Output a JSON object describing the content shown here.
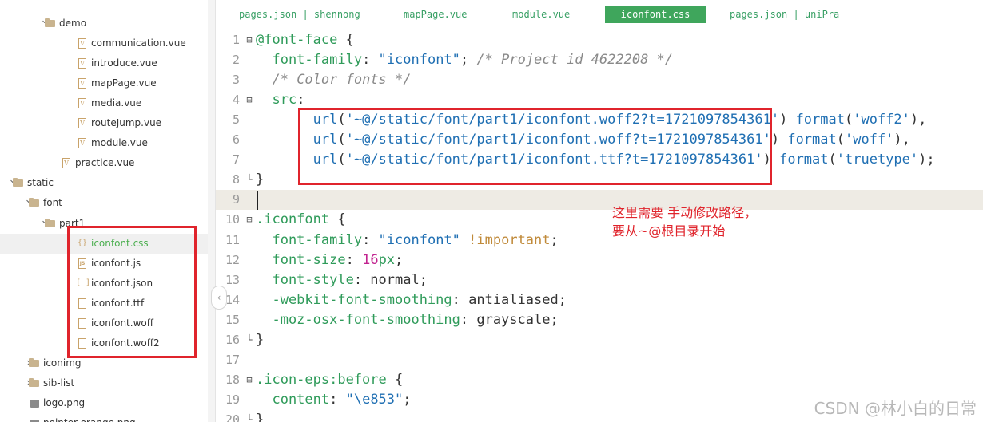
{
  "sidebar": {
    "items": [
      {
        "label": "demo",
        "type": "folder",
        "expanded": true,
        "depth": 3
      },
      {
        "label": "communication.vue",
        "type": "vue",
        "depth": 5
      },
      {
        "label": "introduce.vue",
        "type": "vue",
        "depth": 5
      },
      {
        "label": "mapPage.vue",
        "type": "vue",
        "depth": 5
      },
      {
        "label": "media.vue",
        "type": "vue",
        "depth": 5
      },
      {
        "label": "routeJump.vue",
        "type": "vue",
        "depth": 5
      },
      {
        "label": "module.vue",
        "type": "vue",
        "depth": 5
      },
      {
        "label": "practice.vue",
        "type": "vue",
        "depth": 4
      },
      {
        "label": "static",
        "type": "folder",
        "expanded": true,
        "depth": 1
      },
      {
        "label": "font",
        "type": "folder",
        "expanded": true,
        "depth": 2
      },
      {
        "label": "part1",
        "type": "folder",
        "expanded": true,
        "depth": 3
      },
      {
        "label": "iconfont.css",
        "type": "css",
        "depth": 5,
        "selected": true
      },
      {
        "label": "iconfont.js",
        "type": "js",
        "depth": 5
      },
      {
        "label": "iconfont.json",
        "type": "json",
        "depth": 5
      },
      {
        "label": "iconfont.ttf",
        "type": "file",
        "depth": 5
      },
      {
        "label": "iconfont.woff",
        "type": "file",
        "depth": 5
      },
      {
        "label": "iconfont.woff2",
        "type": "file",
        "depth": 5
      },
      {
        "label": "iconimg",
        "type": "folder",
        "expanded": false,
        "depth": 2
      },
      {
        "label": "sib-list",
        "type": "folder",
        "expanded": false,
        "depth": 2
      },
      {
        "label": "logo.png",
        "type": "image",
        "depth": 2
      },
      {
        "label": "pointer-orange.png",
        "type": "image",
        "depth": 2
      }
    ]
  },
  "tabs": [
    {
      "label": "pages.json | shennong",
      "active": false
    },
    {
      "label": "mapPage.vue",
      "active": false
    },
    {
      "label": "module.vue",
      "active": false
    },
    {
      "label": "iconfont.css",
      "active": true
    },
    {
      "label": "pages.json | uniPra",
      "active": false
    }
  ],
  "editor": {
    "current_line": 9,
    "lines": [
      {
        "n": "1",
        "fold": "⊟",
        "tokens": [
          {
            "t": "@font-face",
            "c": "at"
          },
          {
            "t": " {",
            "c": "p"
          }
        ]
      },
      {
        "n": "2",
        "fold": "",
        "tokens": [
          {
            "t": "  font-family",
            "c": "prop"
          },
          {
            "t": ": ",
            "c": "p"
          },
          {
            "t": "\"iconfont\"",
            "c": "str"
          },
          {
            "t": "; ",
            "c": "p"
          },
          {
            "t": "/* Project id 4622208 */",
            "c": "cmt"
          }
        ]
      },
      {
        "n": "3",
        "fold": "",
        "tokens": [
          {
            "t": "  ",
            "c": "p"
          },
          {
            "t": "/* Color fonts */",
            "c": "cmt"
          }
        ]
      },
      {
        "n": "4",
        "fold": "⊟",
        "tokens": [
          {
            "t": "  src",
            "c": "prop"
          },
          {
            "t": ":",
            "c": "p"
          }
        ]
      },
      {
        "n": "5",
        "fold": "",
        "tokens": [
          {
            "t": "       ",
            "c": "p"
          },
          {
            "t": "url",
            "c": "fn"
          },
          {
            "t": "(",
            "c": "p"
          },
          {
            "t": "'~@/static/font/part1/iconfont.woff2?t=1721097854361'",
            "c": "str"
          },
          {
            "t": ") ",
            "c": "p"
          },
          {
            "t": "format",
            "c": "fn"
          },
          {
            "t": "(",
            "c": "p"
          },
          {
            "t": "'woff2'",
            "c": "str"
          },
          {
            "t": "),",
            "c": "p"
          }
        ]
      },
      {
        "n": "6",
        "fold": "",
        "tokens": [
          {
            "t": "       ",
            "c": "p"
          },
          {
            "t": "url",
            "c": "fn"
          },
          {
            "t": "(",
            "c": "p"
          },
          {
            "t": "'~@/static/font/part1/iconfont.woff?t=1721097854361'",
            "c": "str"
          },
          {
            "t": ") ",
            "c": "p"
          },
          {
            "t": "format",
            "c": "fn"
          },
          {
            "t": "(",
            "c": "p"
          },
          {
            "t": "'woff'",
            "c": "str"
          },
          {
            "t": "),",
            "c": "p"
          }
        ]
      },
      {
        "n": "7",
        "fold": "",
        "tokens": [
          {
            "t": "       ",
            "c": "p"
          },
          {
            "t": "url",
            "c": "fn"
          },
          {
            "t": "(",
            "c": "p"
          },
          {
            "t": "'~@/static/font/part1/iconfont.ttf?t=1721097854361'",
            "c": "str"
          },
          {
            "t": ") ",
            "c": "p"
          },
          {
            "t": "format",
            "c": "fn"
          },
          {
            "t": "(",
            "c": "p"
          },
          {
            "t": "'truetype'",
            "c": "str"
          },
          {
            "t": ");",
            "c": "p"
          }
        ]
      },
      {
        "n": "8",
        "fold": "└",
        "tokens": [
          {
            "t": "}",
            "c": "p"
          }
        ]
      },
      {
        "n": "9",
        "fold": "",
        "tokens": []
      },
      {
        "n": "10",
        "fold": "⊟",
        "tokens": [
          {
            "t": ".iconfont",
            "c": "sel"
          },
          {
            "t": " {",
            "c": "p"
          }
        ]
      },
      {
        "n": "11",
        "fold": "",
        "tokens": [
          {
            "t": "  font-family",
            "c": "prop"
          },
          {
            "t": ": ",
            "c": "p"
          },
          {
            "t": "\"iconfont\"",
            "c": "str"
          },
          {
            "t": " ",
            "c": "p"
          },
          {
            "t": "!important",
            "c": "imp"
          },
          {
            "t": ";",
            "c": "p"
          }
        ]
      },
      {
        "n": "12",
        "fold": "",
        "tokens": [
          {
            "t": "  font-size",
            "c": "prop"
          },
          {
            "t": ": ",
            "c": "p"
          },
          {
            "t": "16",
            "c": "num"
          },
          {
            "t": "px",
            "c": "sel"
          },
          {
            "t": ";",
            "c": "p"
          }
        ]
      },
      {
        "n": "13",
        "fold": "",
        "tokens": [
          {
            "t": "  font-style",
            "c": "prop"
          },
          {
            "t": ": normal;",
            "c": "p"
          }
        ]
      },
      {
        "n": "14",
        "fold": "",
        "tokens": [
          {
            "t": "  -webkit-font-smoothing",
            "c": "prop"
          },
          {
            "t": ": antialiased;",
            "c": "p"
          }
        ]
      },
      {
        "n": "15",
        "fold": "",
        "tokens": [
          {
            "t": "  -moz-osx-font-smoothing",
            "c": "prop"
          },
          {
            "t": ": grayscale;",
            "c": "p"
          }
        ]
      },
      {
        "n": "16",
        "fold": "└",
        "tokens": [
          {
            "t": "}",
            "c": "p"
          }
        ]
      },
      {
        "n": "17",
        "fold": "",
        "tokens": []
      },
      {
        "n": "18",
        "fold": "⊟",
        "tokens": [
          {
            "t": ".icon-eps:before",
            "c": "sel"
          },
          {
            "t": " {",
            "c": "p"
          }
        ]
      },
      {
        "n": "19",
        "fold": "",
        "tokens": [
          {
            "t": "  content",
            "c": "prop"
          },
          {
            "t": ": ",
            "c": "p"
          },
          {
            "t": "\"\\e853\"",
            "c": "str"
          },
          {
            "t": ";",
            "c": "p"
          }
        ]
      },
      {
        "n": "20",
        "fold": "└",
        "tokens": [
          {
            "t": "}",
            "c": "p"
          }
        ]
      }
    ]
  },
  "annotation": {
    "line1": "这里需要 手动修改路径，",
    "line2": "要从~@根目录开始"
  },
  "watermark": "CSDN @林小白的日常",
  "colors": {
    "accent": "#3fa65c",
    "highlight_box": "#e0242c",
    "annotation_text": "#e0242c"
  }
}
